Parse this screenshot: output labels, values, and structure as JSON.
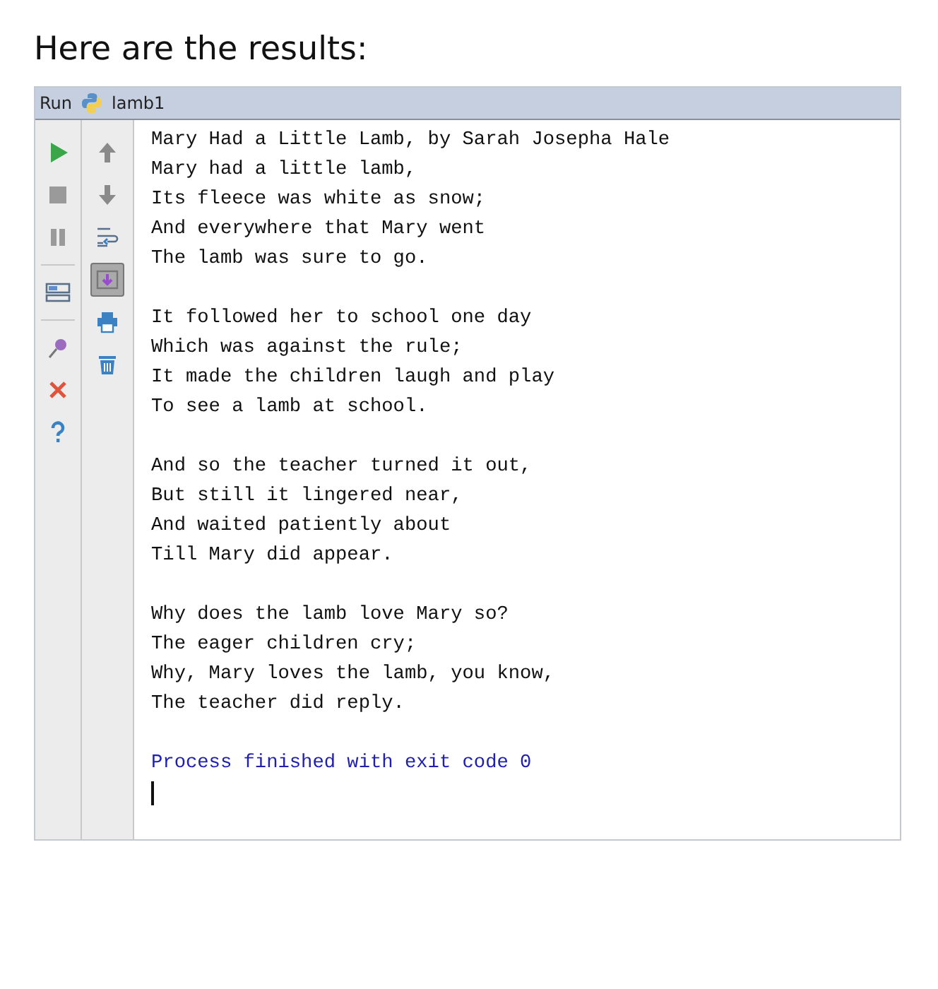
{
  "heading": "Here are the results:",
  "run_panel": {
    "label": "Run",
    "config": "lamb1"
  },
  "left_toolbar": [
    {
      "kind": "run"
    },
    {
      "kind": "stop"
    },
    {
      "kind": "pause"
    },
    {
      "kind": "separator"
    },
    {
      "kind": "layout"
    },
    {
      "kind": "separator"
    },
    {
      "kind": "pin"
    },
    {
      "kind": "close"
    },
    {
      "kind": "help"
    }
  ],
  "right_toolbar": [
    {
      "kind": "up",
      "on": false
    },
    {
      "kind": "down",
      "on": false
    },
    {
      "kind": "wrap",
      "on": false
    },
    {
      "kind": "scroll",
      "on": true
    },
    {
      "kind": "print",
      "on": false
    },
    {
      "kind": "trash",
      "on": false
    }
  ],
  "output": {
    "stanzas": [
      [
        "Mary Had a Little Lamb, by Sarah Josepha Hale",
        "Mary had a little lamb,",
        "Its fleece was white as snow;",
        "And everywhere that Mary went",
        "The lamb was sure to go."
      ],
      [
        "It followed her to school one day",
        "Which was against the rule;",
        "It made the children laugh and play",
        "To see a lamb at school."
      ],
      [
        "And so the teacher turned it out,",
        "But still it lingered near,",
        "And waited patiently about",
        "Till Mary did appear."
      ],
      [
        "Why does the lamb love Mary so?",
        "The eager children cry;",
        "Why, Mary loves the lamb, you know,",
        "The teacher did reply."
      ]
    ],
    "exit_message": "Process finished with exit code 0"
  }
}
